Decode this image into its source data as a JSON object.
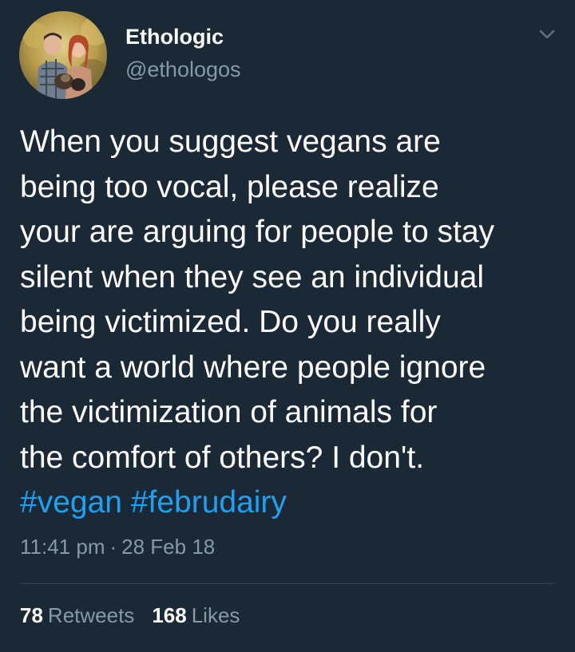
{
  "author": {
    "display_name": "Ethologic",
    "handle": "@ethologos",
    "avatar_icon": "profile-photo"
  },
  "menu_icon": "chevron-down-icon",
  "tweet": {
    "lines": [
      "When you suggest vegans are",
      "being too vocal, please realize",
      "your are arguing for people to stay",
      "silent when they see an individual",
      "being victimized. Do you really",
      "want a world where people ignore",
      "the victimization of animals for",
      "the comfort of others? I don't."
    ],
    "hashtags": [
      "#vegan",
      "#februdairy"
    ]
  },
  "meta": {
    "time": "11:41 pm",
    "separator": "·",
    "date": "28 Feb 18"
  },
  "stats": {
    "retweets_count": "78",
    "retweets_label": "Retweets",
    "likes_count": "168",
    "likes_label": "Likes"
  },
  "colors": {
    "background": "#1b2836",
    "text": "#ffffff",
    "secondary": "#8899a6",
    "link": "#1da1f2",
    "divider": "#38444d"
  }
}
